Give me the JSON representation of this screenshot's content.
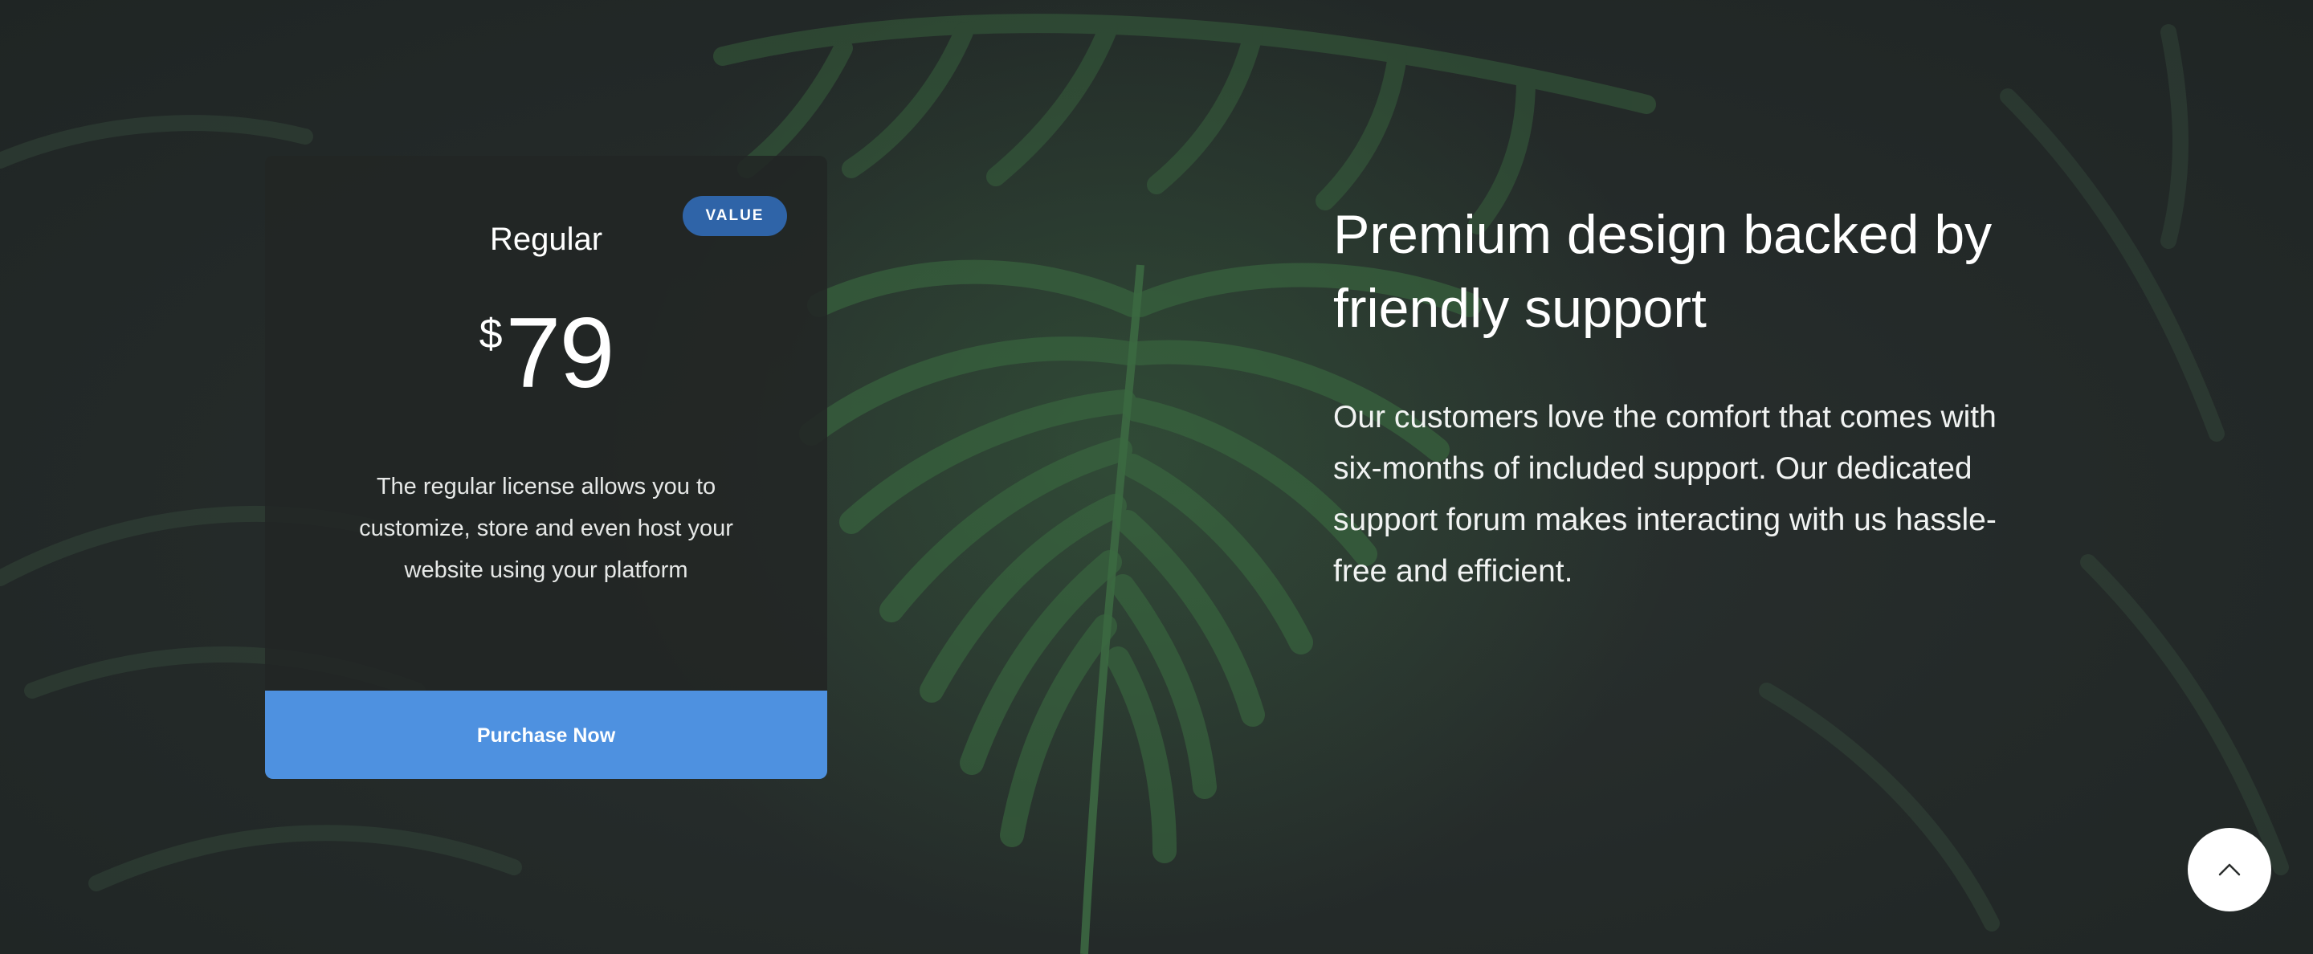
{
  "pricing_card": {
    "plan_name": "Regular",
    "badge": "VALUE",
    "currency_symbol": "$",
    "price": "79",
    "description": "The regular license allows you to customize, store and even host your website using your platform",
    "purchase_label": "Purchase Now"
  },
  "copy": {
    "headline": "Premium design backed by friendly support",
    "body": "Our customers love the comfort that comes with six-months of included support. Our dedicated support forum makes interacting with us hassle-free and efficient."
  },
  "icons": {
    "scroll_top": "chevron-up-icon"
  },
  "colors": {
    "background": "#242a29",
    "card": "#222524",
    "badge": "#2f64a8",
    "button": "#4e91e0",
    "foliage": "#2e5a35"
  }
}
